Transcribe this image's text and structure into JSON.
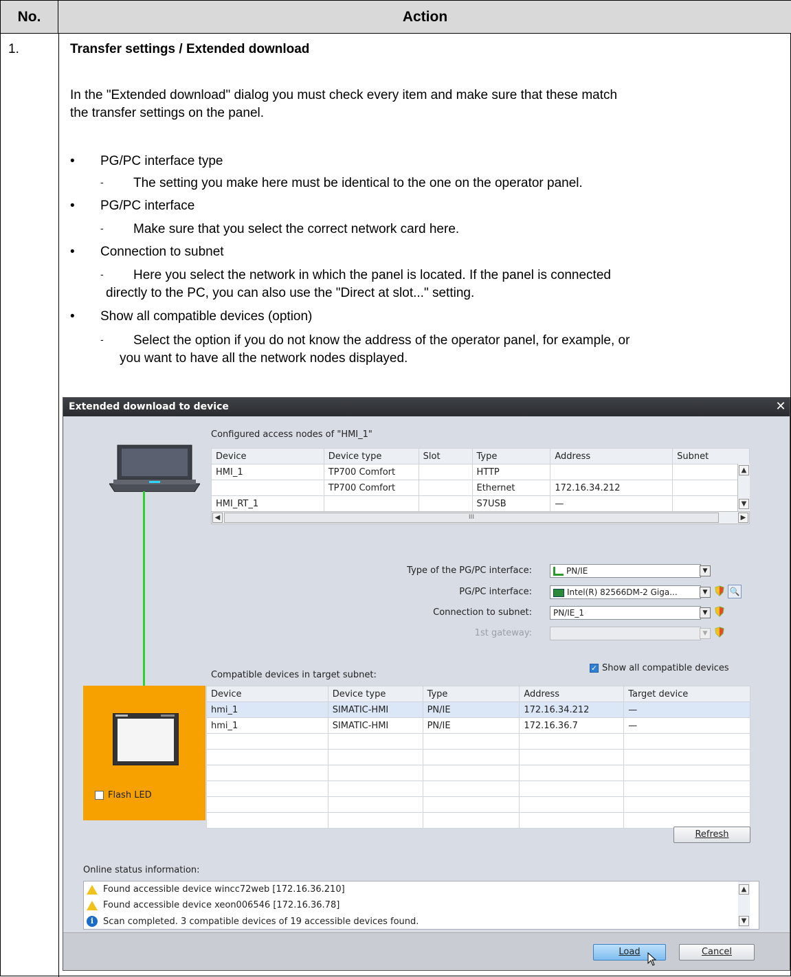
{
  "table_header": {
    "no": "No.",
    "action": "Action"
  },
  "step": {
    "number": "1.",
    "title": "Transfer settings / Extended download",
    "intro_line1": "In the \"Extended download\" dialog you must check every item and make sure that these match",
    "intro_line2": "the transfer settings on the panel.",
    "bullets": [
      {
        "label": "PG/PC interface type",
        "detail1": "The setting you make here must be identical to the one on the operator panel.",
        "detail2": ""
      },
      {
        "label": "PG/PC interface",
        "detail1": "Make sure that you select the correct network card here.",
        "detail2": ""
      },
      {
        "label": "Connection to subnet",
        "detail1": "Here you select the network in which the panel is located. If the panel is connected",
        "detail2": "directly to the PC, you can also use the \"Direct at slot...\" setting."
      },
      {
        "label": "Show all compatible devices (option)",
        "detail1": "Select the option if you do not know the address of the operator panel, for example, or",
        "detail2": "you want to have all the network nodes displayed."
      }
    ],
    "bullet_char": "•",
    "dash_char": "-"
  },
  "dialog": {
    "title": "Extended download to device",
    "close": "✕",
    "configured_label": "Configured access nodes of \"HMI_1\"",
    "configured_headers": [
      "Device",
      "Device type",
      "Slot",
      "Type",
      "Address",
      "Subnet"
    ],
    "configured_rows": [
      [
        "HMI_1",
        "TP700 Comfort",
        "",
        "HTTP",
        "",
        ""
      ],
      [
        "",
        "TP700 Comfort",
        "",
        "Ethernet",
        "172.16.34.212",
        ""
      ],
      [
        "HMI_RT_1",
        "",
        "",
        "S7USB",
        "—",
        ""
      ]
    ],
    "hscroll_thumb": "III",
    "type_label": "Type of the PG/PC interface:",
    "type_value": "PN/IE",
    "interface_label": "PG/PC interface:",
    "interface_value": "Intel(R) 82566DM-2 Giga...",
    "subnet_label": "Connection to subnet:",
    "subnet_value": "PN/IE_1",
    "gateway_label": "1st gateway:",
    "gateway_value": "",
    "show_all_label": "Show all compatible devices",
    "compatible_label": "Compatible devices in target subnet:",
    "compatible_headers": [
      "Device",
      "Device type",
      "Type",
      "Address",
      "Target device"
    ],
    "compatible_rows": [
      [
        "hmi_1",
        "SIMATIC-HMI",
        "PN/IE",
        "172.16.34.212",
        "—"
      ],
      [
        "hmi_1",
        "SIMATIC-HMI",
        "PN/IE",
        "172.16.36.7",
        "—"
      ],
      [
        "",
        "",
        "",
        "",
        ""
      ],
      [
        "",
        "",
        "",
        "",
        ""
      ],
      [
        "",
        "",
        "",
        "",
        ""
      ],
      [
        "",
        "",
        "",
        "",
        ""
      ],
      [
        "",
        "",
        "",
        "",
        ""
      ]
    ],
    "flash_led": "Flash LED",
    "refresh": "Refresh",
    "online_status_label": "Online status information:",
    "status_lines": [
      {
        "icon": "warning-icon",
        "text": "Found accessible device wincc72web [172.16.36.210]"
      },
      {
        "icon": "warning-icon",
        "text": "Found accessible device xeon006546 [172.16.36.78]"
      },
      {
        "icon": "info-icon",
        "text": "Scan completed. 3 compatible devices of 19 accessible devices found."
      }
    ],
    "load": "Load",
    "cancel": "Cancel"
  }
}
